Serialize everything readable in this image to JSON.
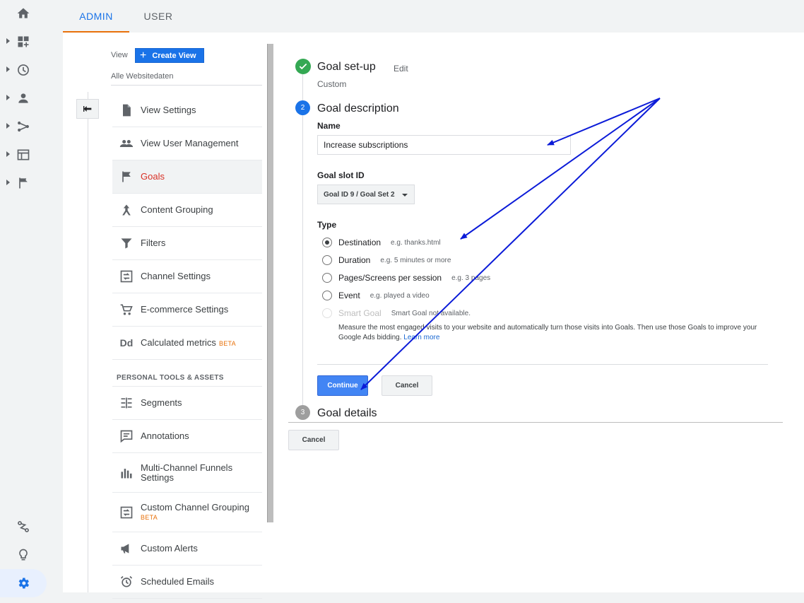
{
  "rail": {
    "items": [
      {
        "icon": "home-icon"
      },
      {
        "icon": "dashboard-icon"
      },
      {
        "icon": "clock-icon"
      },
      {
        "icon": "person-icon"
      },
      {
        "icon": "acquisition-icon"
      },
      {
        "icon": "behavior-icon"
      },
      {
        "icon": "flag-icon"
      }
    ],
    "bottom": [
      {
        "icon": "path-icon"
      },
      {
        "icon": "lightbulb-icon"
      },
      {
        "icon": "gear-icon"
      }
    ]
  },
  "tabs": {
    "admin": "ADMIN",
    "user": "USER"
  },
  "view": {
    "label": "View",
    "create_button": "Create View",
    "name": "Alle Websitedaten"
  },
  "menu": {
    "items": [
      {
        "label": "View Settings",
        "icon": "document-icon"
      },
      {
        "label": "View User Management",
        "icon": "people-icon"
      },
      {
        "label": "Goals",
        "icon": "flag-icon"
      },
      {
        "label": "Content Grouping",
        "icon": "content-grouping-icon"
      },
      {
        "label": "Filters",
        "icon": "filter-icon"
      },
      {
        "label": "Channel Settings",
        "icon": "channel-icon"
      },
      {
        "label": "E-commerce Settings",
        "icon": "cart-icon"
      },
      {
        "label": "Calculated metrics",
        "badge": "BETA",
        "icon": "dd-icon"
      }
    ],
    "section_heading": "PERSONAL TOOLS & ASSETS",
    "tools": [
      {
        "label": "Segments",
        "icon": "segments-icon"
      },
      {
        "label": "Annotations",
        "icon": "annotation-icon"
      },
      {
        "label": "Multi-Channel Funnels Settings",
        "icon": "bar-chart-icon"
      },
      {
        "label": "Custom Channel Grouping",
        "badge": "BETA",
        "icon": "channel-icon"
      },
      {
        "label": "Custom Alerts",
        "icon": "megaphone-icon"
      },
      {
        "label": "Scheduled Emails",
        "icon": "alarm-icon"
      }
    ]
  },
  "goal": {
    "step1": {
      "title": "Goal set-up",
      "edit": "Edit",
      "value": "Custom",
      "number": ""
    },
    "step2": {
      "title": "Goal description",
      "number": "2"
    },
    "step3": {
      "title": "Goal details",
      "number": "3"
    },
    "name_label": "Name",
    "name_value": "Increase subscriptions",
    "slot_label": "Goal slot ID",
    "slot_value": "Goal ID 9 / Goal Set 2",
    "type_label": "Type",
    "types": [
      {
        "label": "Destination",
        "hint": "e.g. thanks.html",
        "checked": true
      },
      {
        "label": "Duration",
        "hint": "e.g. 5 minutes or more",
        "checked": false
      },
      {
        "label": "Pages/Screens per session",
        "hint": "e.g. 3 pages",
        "checked": false
      },
      {
        "label": "Event",
        "hint": "e.g. played a video",
        "checked": false
      },
      {
        "label": "Smart Goal",
        "hint": "Smart Goal not available.",
        "checked": false,
        "disabled": true
      }
    ],
    "smart_desc": "Measure the most engaged visits to your website and automatically turn those visits into Goals. Then use those Goals to improve your Google Ads bidding.",
    "learn_more": "Learn more",
    "continue": "Continue",
    "cancel": "Cancel",
    "cancel_bottom": "Cancel"
  },
  "colors": {
    "accent": "#1a73e8",
    "active_tab_underline": "#e8710a",
    "active_menu": "#d93025",
    "arrow": "#0b1bd8"
  }
}
